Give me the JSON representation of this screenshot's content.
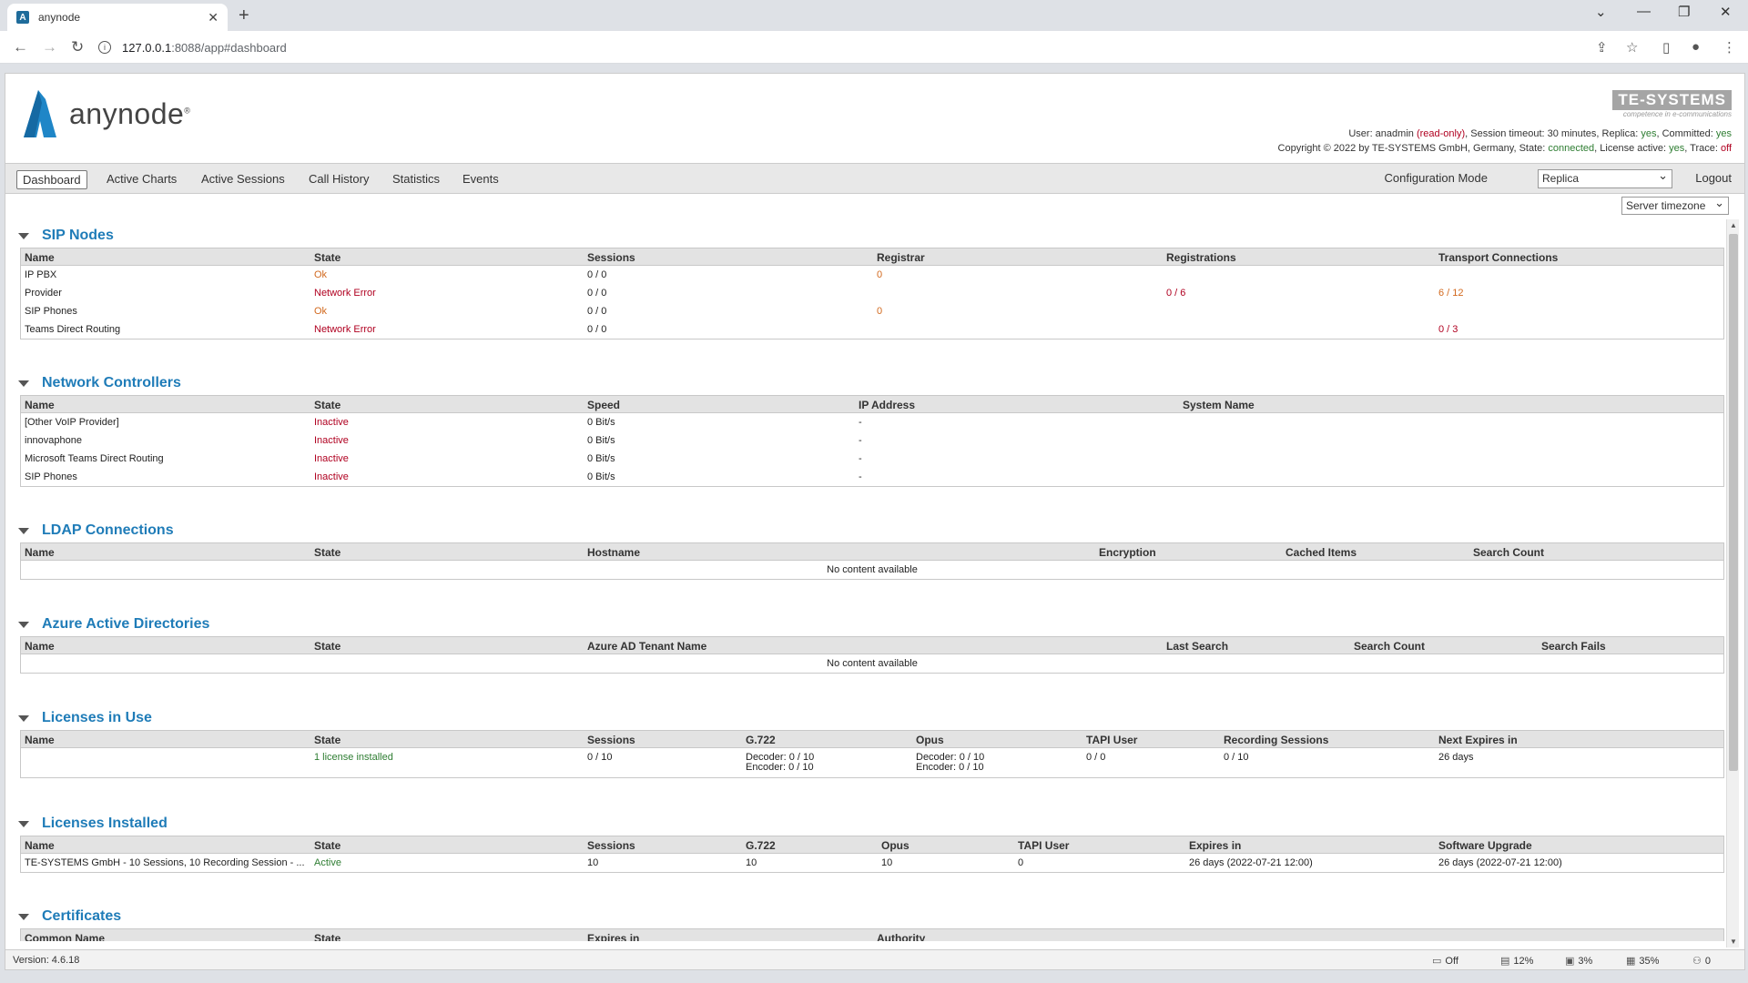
{
  "browser": {
    "tab_title": "anynode",
    "url_host": "127.0.0.1",
    "url_rest": ":8088/app#dashboard"
  },
  "header": {
    "logo_text": "anynode",
    "brand": "TE-SYSTEMS",
    "brand_tag": "competence in e-communications",
    "line1": {
      "user_label": "User: anadmin ",
      "user_mode": "(read-only)",
      "session": ", Session timeout: 30 minutes, Replica: ",
      "replica": "yes",
      "committed_label": ", Committed: ",
      "committed": "yes"
    },
    "line2": {
      "copyright": "Copyright © 2022 by TE-SYSTEMS GmbH, Germany, State: ",
      "state": "connected",
      "license_label": ", License active: ",
      "license": "yes",
      "trace_label": ", Trace: ",
      "trace": "off"
    }
  },
  "menu": {
    "items": [
      "Dashboard",
      "Active Charts",
      "Active Sessions",
      "Call History",
      "Statistics",
      "Events"
    ],
    "config_mode_label": "Configuration Mode",
    "config_mode_value": "Replica",
    "logout": "Logout",
    "timezone": "Server timezone"
  },
  "sections": {
    "sip_nodes": {
      "title": "SIP Nodes",
      "columns": [
        "Name",
        "State",
        "Sessions",
        "Registrar",
        "Registrations",
        "Transport Connections"
      ],
      "rows": [
        {
          "name": "IP PBX",
          "state": "Ok",
          "sessions": "0 / 0",
          "registrar": "0",
          "registrations": "",
          "transport": ""
        },
        {
          "name": "Provider",
          "state": "Network Error",
          "sessions": "0 / 0",
          "registrar": "",
          "registrations": "0 / 6",
          "transport": "6 / 12"
        },
        {
          "name": "SIP Phones",
          "state": "Ok",
          "sessions": "0 / 0",
          "registrar": "0",
          "registrations": "",
          "transport": ""
        },
        {
          "name": "Teams Direct Routing",
          "state": "Network Error",
          "sessions": "0 / 0",
          "registrar": "",
          "registrations": "",
          "transport": "0 / 3"
        }
      ]
    },
    "network_controllers": {
      "title": "Network Controllers",
      "columns": [
        "Name",
        "State",
        "Speed",
        "IP Address",
        "System Name"
      ],
      "rows": [
        {
          "name": "[Other VoIP Provider]",
          "state": "Inactive",
          "speed": "0 Bit/s",
          "ip": "-"
        },
        {
          "name": "innovaphone",
          "state": "Inactive",
          "speed": "0 Bit/s",
          "ip": "-"
        },
        {
          "name": "Microsoft Teams Direct Routing",
          "state": "Inactive",
          "speed": "0 Bit/s",
          "ip": "-"
        },
        {
          "name": "SIP Phones",
          "state": "Inactive",
          "speed": "0 Bit/s",
          "ip": "-"
        }
      ]
    },
    "ldap": {
      "title": "LDAP Connections",
      "columns": [
        "Name",
        "State",
        "Hostname",
        "Encryption",
        "Cached Items",
        "Search Count"
      ],
      "empty": "No content available"
    },
    "azure": {
      "title": "Azure Active Directories",
      "columns": [
        "Name",
        "State",
        "Azure AD Tenant Name",
        "Last Search",
        "Search Count",
        "Search Fails"
      ],
      "empty": "No content available"
    },
    "licenses_in_use": {
      "title": "Licenses in Use",
      "columns": [
        "Name",
        "State",
        "Sessions",
        "G.722",
        "Opus",
        "TAPI User",
        "Recording Sessions",
        "Next Expires in"
      ],
      "row": {
        "state": "1 license installed",
        "sessions": "0 / 10",
        "g722_dec": "Decoder: 0 / 10",
        "g722_enc": "Encoder: 0 / 10",
        "opus_dec": "Decoder: 0 / 10",
        "opus_enc": "Encoder: 0 / 10",
        "tapi": "0 / 0",
        "recording": "0 / 10",
        "expires": "26 days"
      }
    },
    "licenses_installed": {
      "title": "Licenses Installed",
      "columns": [
        "Name",
        "State",
        "Sessions",
        "G.722",
        "Opus",
        "TAPI User",
        "Expires in",
        "Software Upgrade"
      ],
      "row": {
        "name": "TE-SYSTEMS GmbH - 10 Sessions, 10 Recording Session - ...",
        "state": "Active",
        "sessions": "10",
        "g722": "10",
        "opus": "10",
        "tapi": "0",
        "expires": "26 days (2022-07-21 12:00)",
        "upgrade": "26 days (2022-07-21 12:00)"
      }
    },
    "certificates": {
      "title": "Certificates",
      "columns": [
        "Common Name",
        "State",
        "Expires in",
        "Authority"
      ]
    }
  },
  "footer": {
    "version": "Version: 4.6.18",
    "trace": "Off",
    "disk": "12%",
    "cpu": "3%",
    "memory": "35%",
    "sessions": "0"
  }
}
